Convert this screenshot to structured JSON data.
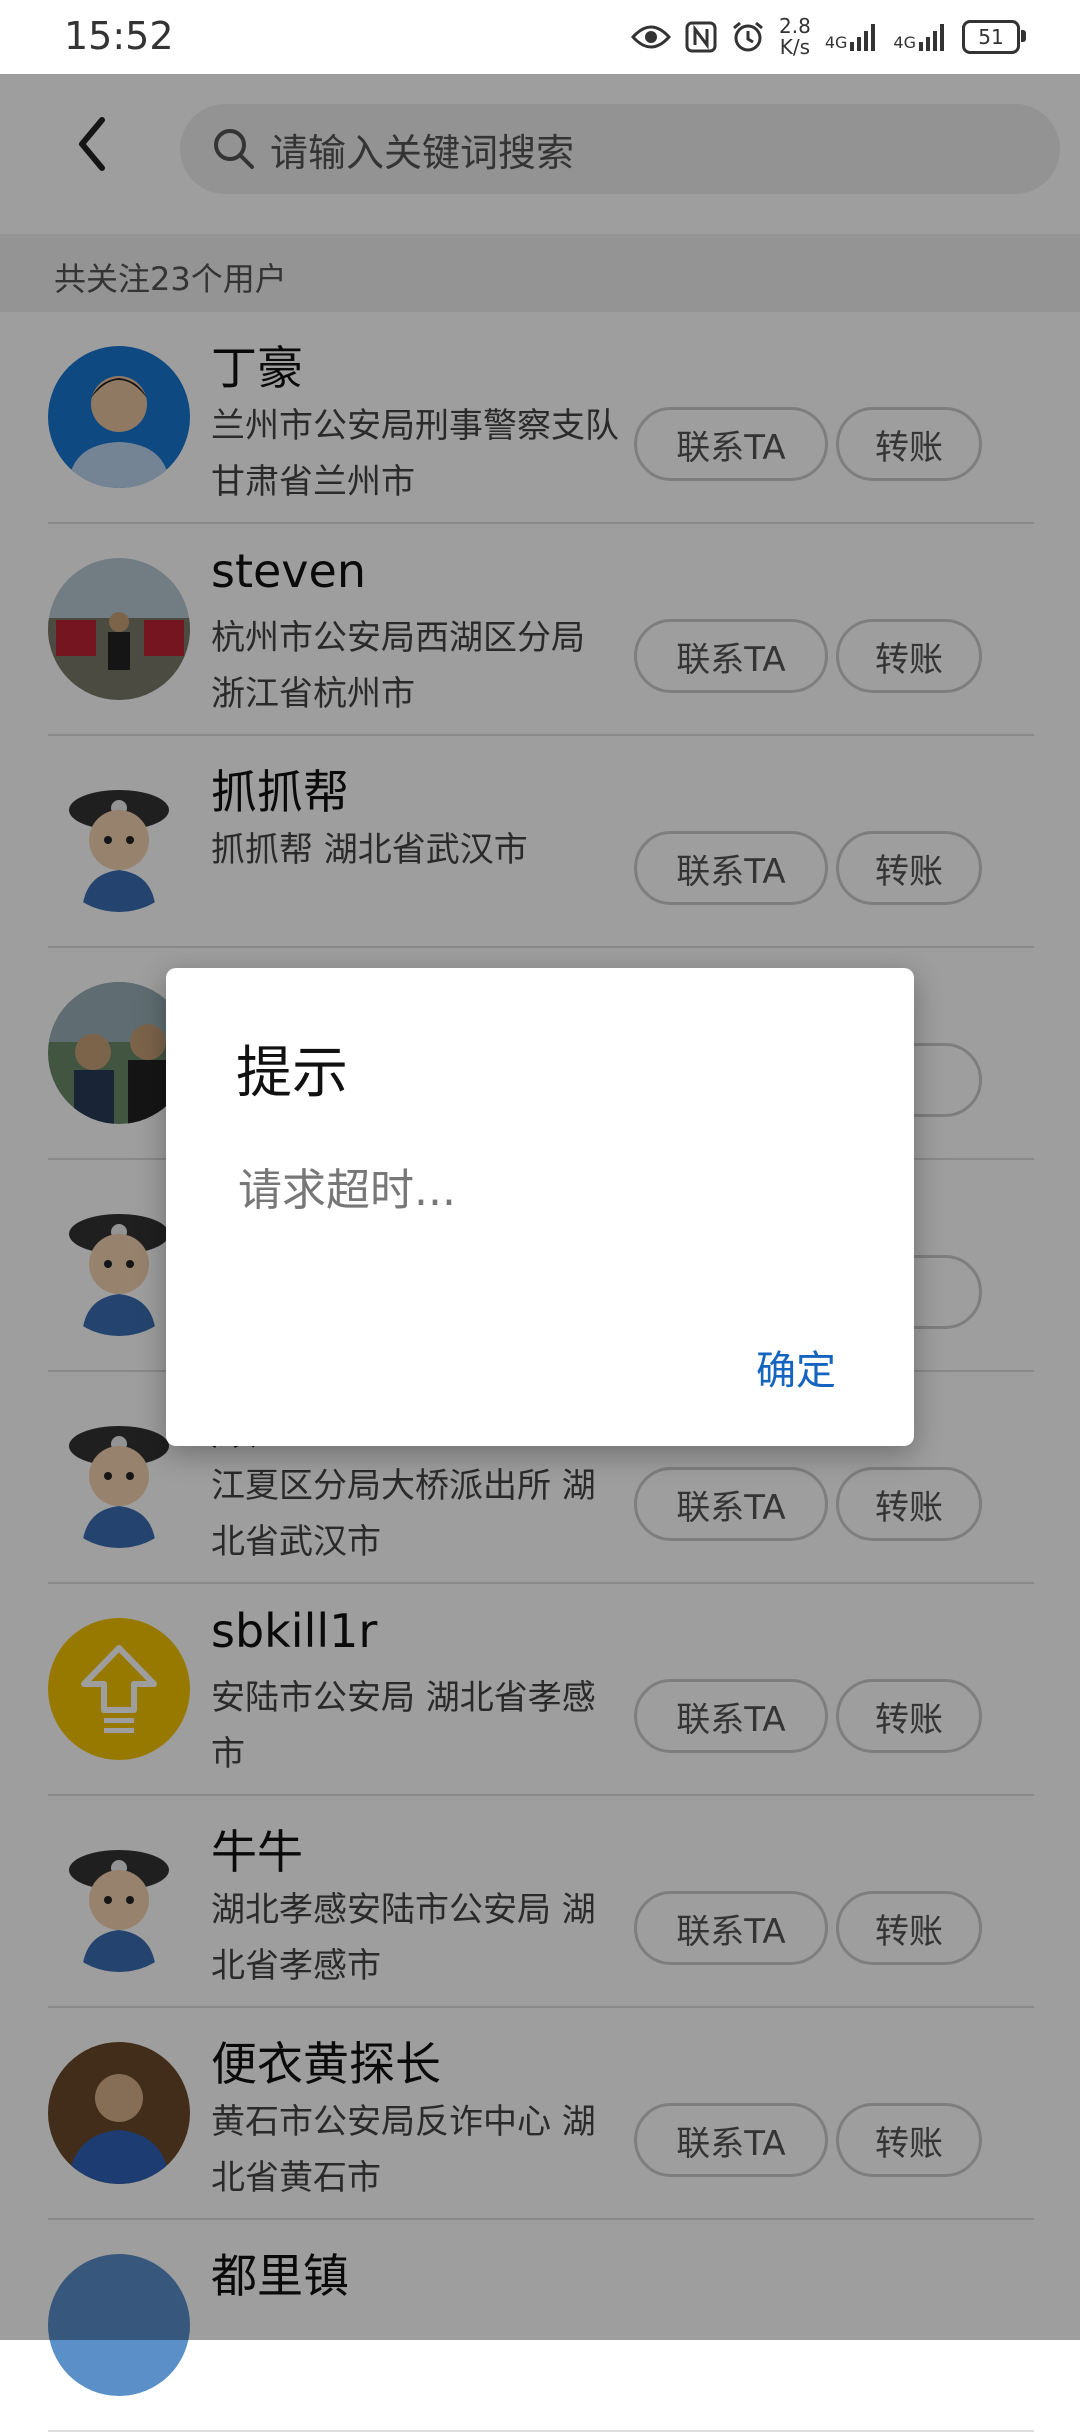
{
  "status_bar": {
    "time": "15:52",
    "net_speed_value": "2.8",
    "net_speed_unit": "K/s",
    "signal1_label": "4G",
    "signal2_label": "4G",
    "battery": "51"
  },
  "header": {
    "search_placeholder": "请输入关键词搜索"
  },
  "follow_count": "共关注23个用户",
  "users": [
    {
      "name": "丁豪",
      "desc": "兰州市公安局刑事警察支队 甘肃省兰州市",
      "contact": "联系TA",
      "transfer": "转账"
    },
    {
      "name": "steven",
      "desc": "杭州市公安局西湖区分局 浙江省杭州市",
      "contact": "联系TA",
      "transfer": "转账"
    },
    {
      "name": "抓抓帮",
      "desc": "抓抓帮 湖北省武汉市",
      "contact": "联系TA",
      "transfer": "转账"
    },
    {
      "name": "",
      "desc": "",
      "contact": "",
      "transfer": ""
    },
    {
      "name": "",
      "desc": "",
      "contact": "",
      "transfer": ""
    },
    {
      "name": "顾",
      "desc": "江夏区分局大桥派出所 湖北省武汉市",
      "contact": "联系TA",
      "transfer": "转账"
    },
    {
      "name": "sbkill1r",
      "desc": "安陆市公安局 湖北省孝感市",
      "contact": "联系TA",
      "transfer": "转账"
    },
    {
      "name": "牛牛",
      "desc": "湖北孝感安陆市公安局 湖北省孝感市",
      "contact": "联系TA",
      "transfer": "转账"
    },
    {
      "name": "便衣黄探长",
      "desc": "黄石市公安局反诈中心 湖北省黄石市",
      "contact": "联系TA",
      "transfer": "转账"
    },
    {
      "name": "都里镇",
      "desc": "",
      "contact": "",
      "transfer": ""
    }
  ],
  "dialog": {
    "title": "提示",
    "message": "请求超时...",
    "ok": "确定"
  }
}
